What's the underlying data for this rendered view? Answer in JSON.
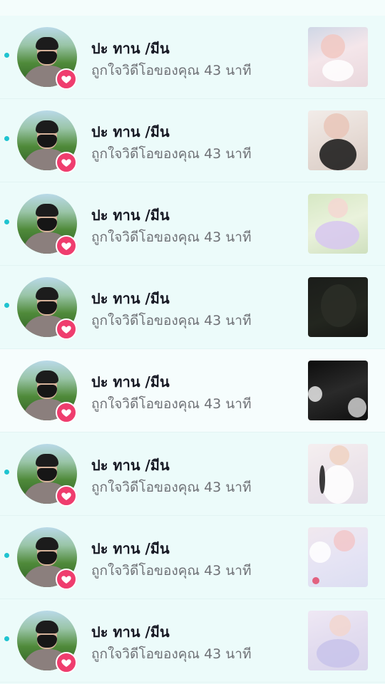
{
  "colors": {
    "unread_dot": "#1fc3d0",
    "heart_badge": "#ef3d6e",
    "name_text": "#161823",
    "activity_text": "#6f7176"
  },
  "notifications": [
    {
      "name": "ปะ ทาน /มีน",
      "activity": "ถูกใจวิดีโอของคุณ 43 นาที",
      "unread": true,
      "thumb_tone": "light-pink"
    },
    {
      "name": "ปะ ทาน /มีน",
      "activity": "ถูกใจวิดีโอของคุณ 43 นาที",
      "unread": true,
      "thumb_tone": "black-top"
    },
    {
      "name": "ปะ ทาน /มีน",
      "activity": "ถูกใจวิดีโอของคุณ 43 นาที",
      "unread": true,
      "thumb_tone": "pastel-green"
    },
    {
      "name": "ปะ ทาน /มีน",
      "activity": "ถูกใจวิดีโอของคุณ 43 นาที",
      "unread": true,
      "thumb_tone": "dark"
    },
    {
      "name": "ปะ ทาน /มีน",
      "activity": "ถูกใจวิดีโอของคุณ 43 นาที",
      "unread": false,
      "thumb_tone": "dark-mono"
    },
    {
      "name": "ปะ ทาน /มีน",
      "activity": "ถูกใจวิดีโอของคุณ 43 นาที",
      "unread": true,
      "thumb_tone": "white-dress"
    },
    {
      "name": "ปะ ทาน /มีน",
      "activity": "ถูกใจวิดีโอของคุณ 43 นาที",
      "unread": true,
      "thumb_tone": "flowers"
    },
    {
      "name": "ปะ ทาน /มีน",
      "activity": "ถูกใจวิดีโอของคุณ 43 นาที",
      "unread": true,
      "thumb_tone": "lavender"
    }
  ]
}
